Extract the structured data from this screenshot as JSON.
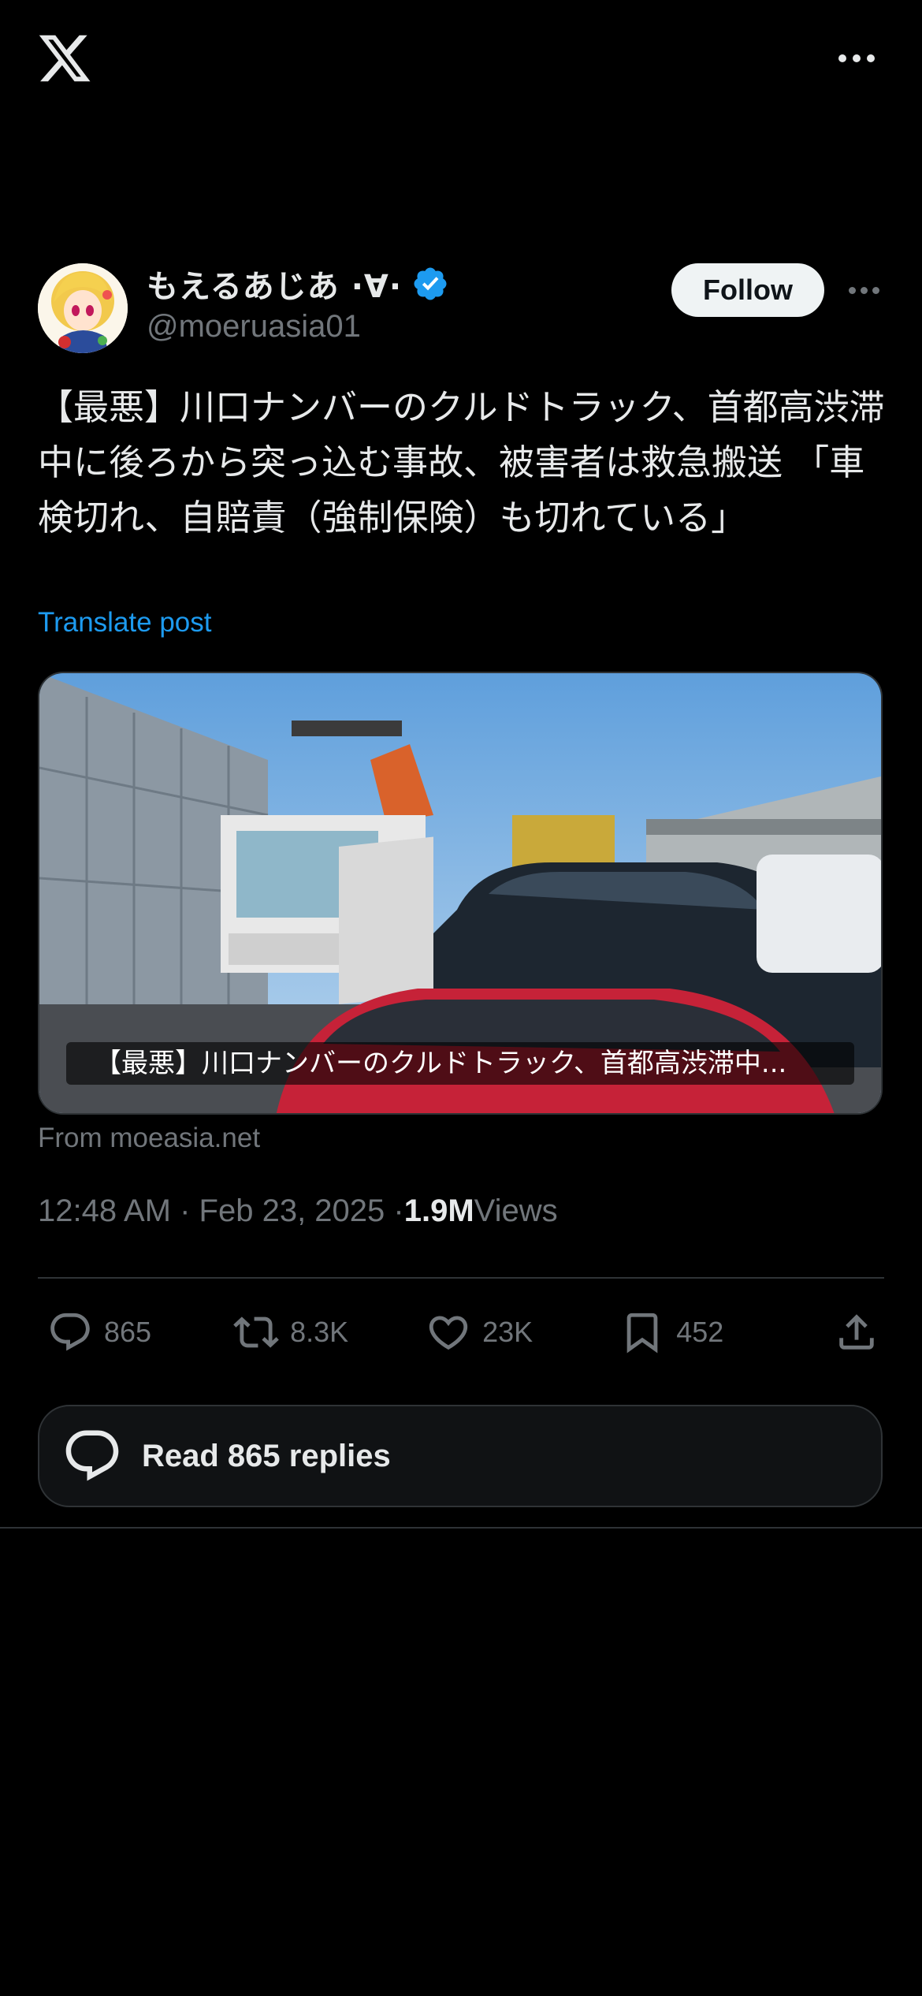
{
  "app": {
    "logo": "x-logo",
    "more_icon": "more-horizontal-icon"
  },
  "author": {
    "name": "もえるあじあ ·∀·",
    "handle": "@moeruasia01",
    "verified": true,
    "follow_label": "Follow"
  },
  "post": {
    "text": "【最悪】川口ナンバーのクルドトラック、首都高渋滞中に後ろから突っ込む事故、被害者は救急搬送 「車検切れ、自賠責（強制保険）も切れている」",
    "translate_label": "Translate post",
    "media_caption": "【最悪】川口ナンバーのクルドトラック、首都高渋滞中...",
    "source": "From moeasia.net",
    "timestamp": "12:48 AM · Feb 23, 2025 · ",
    "views_count": "1.9M",
    "views_label": " Views"
  },
  "actions": {
    "replies": "865",
    "reposts": "8.3K",
    "likes": "23K",
    "bookmarks": "452"
  },
  "read_replies_label": "Read 865 replies",
  "colors": {
    "accent": "#1d9bf0",
    "muted": "#71767b",
    "background": "#000000"
  }
}
